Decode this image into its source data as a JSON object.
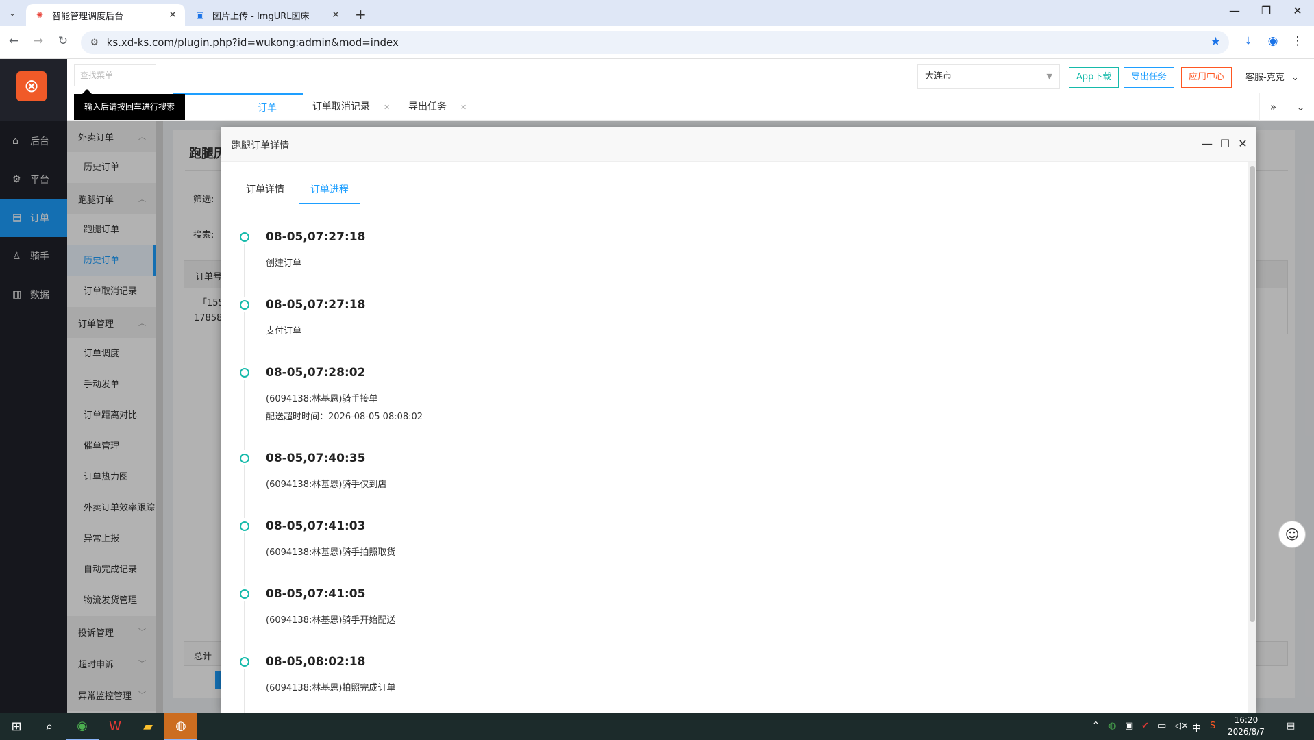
{
  "browser": {
    "tabs": [
      {
        "title": "智能管理调度后台",
        "active": true
      },
      {
        "title": "图片上传 - ImgURL图床",
        "active": false
      }
    ],
    "url": "ks.xd-ks.com/plugin.php?id=wukong:admin&mod=index"
  },
  "header": {
    "search_placeholder": "查找菜单",
    "tooltip": "输入后请按回车进行搜索",
    "city": "大连市",
    "app_download": "App下载",
    "export_task": "导出任务",
    "app_center": "应用中心",
    "user": "客服-克克"
  },
  "page_tabs": [
    {
      "label": "订单",
      "active": true
    },
    {
      "label": "订单取消记录",
      "active": false
    },
    {
      "label": "导出任务",
      "active": false
    }
  ],
  "nav": [
    {
      "label": "后台",
      "icon": "home-icon"
    },
    {
      "label": "平台",
      "icon": "gear-icon"
    },
    {
      "label": "订单",
      "icon": "document-icon",
      "active": true
    },
    {
      "label": "骑手",
      "icon": "user-icon"
    },
    {
      "label": "数据",
      "icon": "chart-icon"
    }
  ],
  "menu": {
    "g1": "外卖订单",
    "g1_items": [
      "历史订单"
    ],
    "g2": "跑腿订单",
    "g2_items": [
      "跑腿订单",
      "历史订单",
      "订单取消记录"
    ],
    "g3": "订单管理",
    "g3_items": [
      "订单调度",
      "手动发单",
      "订单距离对比",
      "催单管理",
      "订单热力图",
      "外卖订单效率跟踪",
      "异常上报",
      "自动完成记录",
      "物流发货管理"
    ],
    "g4": "投诉管理",
    "g5": "超时申诉",
    "g6": "异常监控管理"
  },
  "background": {
    "title": "跑腿历",
    "filter_label": "筛选:",
    "search_label": "搜索:",
    "col_order_no": "订单号",
    "cell1": "「155",
    "cell2": "17858",
    "total": "总计"
  },
  "modal": {
    "title": "跑腿订单详情",
    "tab_detail": "订单详情",
    "tab_progress": "订单进程",
    "timeline": [
      {
        "time": "08-05,07:27:18",
        "lines": [
          "创建订单"
        ]
      },
      {
        "time": "08-05,07:27:18",
        "lines": [
          "支付订单"
        ]
      },
      {
        "time": "08-05,07:28:02",
        "lines": [
          "(6094138:林基恩)骑手接单",
          "配送超时时间：2026-08-05 08:08:02"
        ]
      },
      {
        "time": "08-05,07:40:35",
        "lines": [
          "(6094138:林基恩)骑手仅到店"
        ]
      },
      {
        "time": "08-05,07:41:03",
        "lines": [
          "(6094138:林基恩)骑手拍照取货"
        ]
      },
      {
        "time": "08-05,07:41:05",
        "lines": [
          "(6094138:林基恩)骑手开始配送"
        ]
      },
      {
        "time": "08-05,08:02:18",
        "lines": [
          "(6094138:林基恩)拍照完成订单"
        ]
      }
    ]
  },
  "taskbar": {
    "ime": "中",
    "time": "16:20",
    "date": "2026/8/7"
  },
  "colors": {
    "primary": "#1e9fff",
    "teal": "#16baaa",
    "orange": "#ff5722",
    "sidebar_dark": "#20222a"
  }
}
